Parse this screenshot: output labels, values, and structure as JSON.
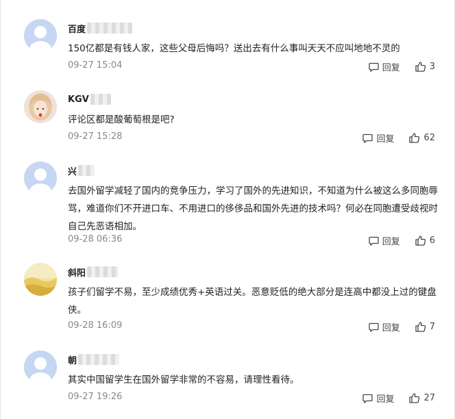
{
  "comments": [
    {
      "user": "百度",
      "text": "150亿都是有钱人家，这些父母后悔吗？送出去有什么事叫天天不应叫地地不灵的",
      "time": "09-27 15:04",
      "reply": "回复",
      "likes": "3",
      "avatar": "default-avatar"
    },
    {
      "user": "KGV",
      "text": "评论区都是酸葡萄根是吧?",
      "time": "09-27 15:28",
      "reply": "回复",
      "likes": "62",
      "avatar": "girl-avatar"
    },
    {
      "user": "兴",
      "text": "去国外留学减轻了国内的竞争压力，学习了国外的先进知识，不知道为什么被这么多同胞辱骂，难道你们不开进口车、不用进口的侈侈品和国外先进的技术吗？何必在同胞遭受歧视时自己先恶语相加。",
      "time": "09-28 06:36",
      "reply": "回复",
      "likes": "6",
      "avatar": "default-avatar"
    },
    {
      "user": "斜阳",
      "text": "孩子们留学不易，至少成绩优秀+英语过关。恶意贬低的绝大部分是连高中都没上过的键盘侠。",
      "time": "09-28 16:09",
      "reply": "回复",
      "likes": "7",
      "avatar": "landscape-avatar"
    },
    {
      "user": "朝",
      "text": "其实中国留学生在国外留学非常的不容易，请理性看待。",
      "time": "09-27 19:26",
      "reply": "回复",
      "likes": "27",
      "avatar": "default-avatar"
    }
  ]
}
